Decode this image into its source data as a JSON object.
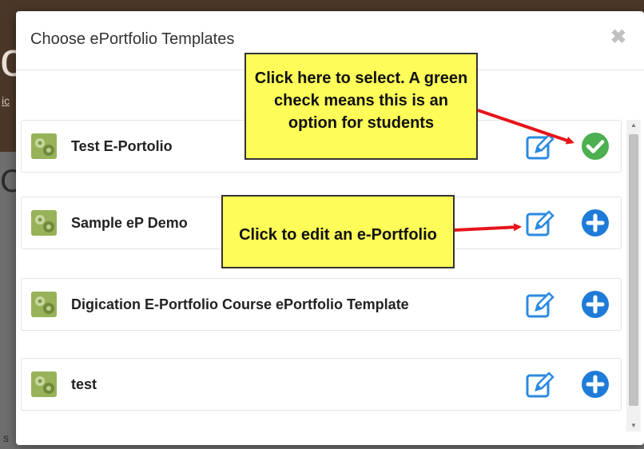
{
  "background": {
    "fragments": [
      "o",
      "ic",
      "C",
      "s"
    ]
  },
  "modal": {
    "title": "Choose ePortfolio Templates",
    "close_symbol": "✖"
  },
  "templates": [
    {
      "name": "Test E-Portolio",
      "edit_icon": "edit-icon",
      "action_icon": "check-circle-icon",
      "selected": true
    },
    {
      "name": "Sample eP Demo",
      "edit_icon": "edit-icon",
      "action_icon": "plus-circle-icon",
      "selected": false
    },
    {
      "name": "Digication E-Portfolio Course ePortfolio Template",
      "edit_icon": "edit-icon",
      "action_icon": "plus-circle-icon",
      "selected": false
    },
    {
      "name": "test",
      "edit_icon": "edit-icon",
      "action_icon": "plus-circle-icon",
      "selected": false
    }
  ],
  "callouts": {
    "select": "Click here to select. A green check means this is an option for students",
    "edit": "Click to edit an e-Portfolio"
  },
  "scrollbar": {
    "up_symbol": "▲",
    "down_symbol": "▼"
  },
  "colors": {
    "check_green": "#4caf50",
    "plus_blue": "#1f7bd8",
    "edit_blue": "#2a8ae0",
    "callout_yellow": "#fdfc58",
    "arrow_red": "#e8141b"
  }
}
